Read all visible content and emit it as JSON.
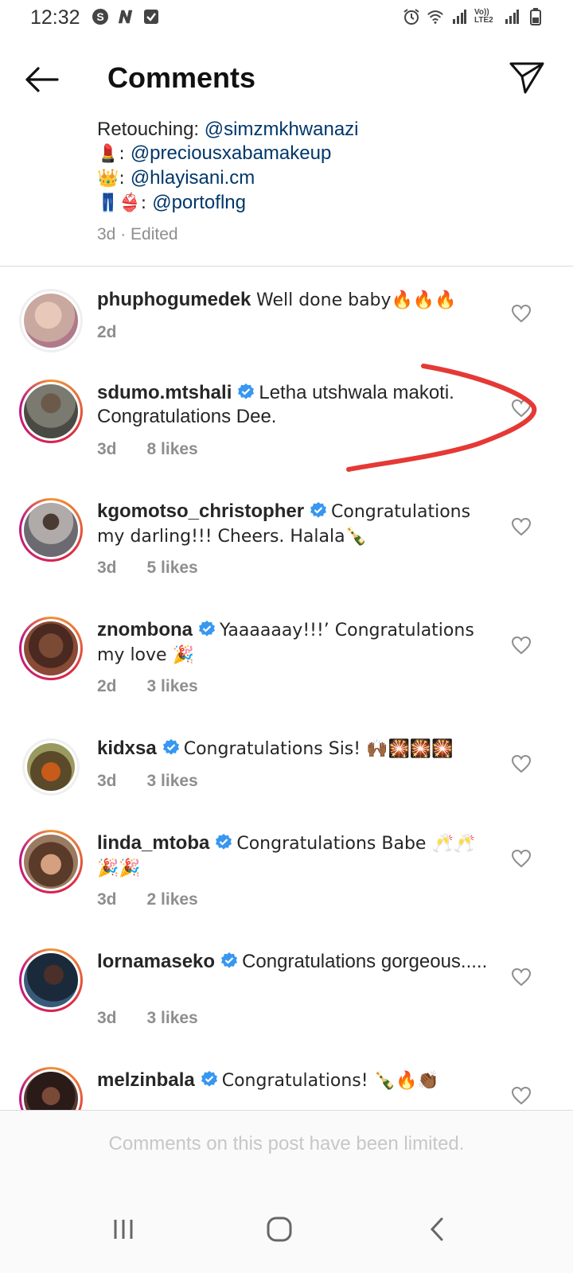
{
  "status_bar": {
    "time": "12:32",
    "left_icons": [
      "skype-icon",
      "n-icon",
      "check-icon"
    ],
    "right_icons": [
      "alarm-icon",
      "wifi-icon",
      "signal-icon",
      "volte-icon",
      "signal-icon",
      "battery-icon"
    ],
    "volte_label": "Vo)) LTE2"
  },
  "header": {
    "title": "Comments"
  },
  "caption": {
    "lines": [
      {
        "prefix": "Retouching: ",
        "mention": "@simzmkhwanazi"
      },
      {
        "prefix": "💄: ",
        "mention": "@preciousxabamakeup"
      },
      {
        "prefix": "👑: ",
        "mention": "@hlayisani.cm"
      },
      {
        "prefix": "👖👙: ",
        "mention": "@portoflng"
      }
    ],
    "meta": "3d · Edited"
  },
  "comments": [
    {
      "username": "phuphogumedek",
      "verified": false,
      "text": "Well done baby🔥🔥🔥",
      "time": "2d",
      "likes": "",
      "story_ring": false,
      "avatar_color": "#c9a8a0"
    },
    {
      "username": "sdumo.mtshali",
      "verified": true,
      "text": "Letha utshwala makoti. Congratulations Dee.",
      "time": "3d",
      "likes": "8 likes",
      "story_ring": true,
      "avatar_color": "#5a5a52"
    },
    {
      "username": "kgomotso_christopher",
      "verified": true,
      "text": "Congratulations my darling!!! Cheers. Halala🍾",
      "time": "3d",
      "likes": "5 likes",
      "story_ring": true,
      "avatar_color": "#8d8f94"
    },
    {
      "username": "znombona",
      "verified": true,
      "text": "Yaaaaaay!!!’ Congratulations my love 🎉",
      "time": "2d",
      "likes": "3 likes",
      "story_ring": true,
      "avatar_color": "#6e4130"
    },
    {
      "username": "kidxsa",
      "verified": true,
      "text": "Congratulations Sis! 🙌🏾🎇🎇🎇",
      "time": "3d",
      "likes": "3 likes",
      "story_ring": false,
      "avatar_color": "#7a6a3a"
    },
    {
      "username": "linda_mtoba",
      "verified": true,
      "text": "Congratulations Babe 🥂🥂🎉🎉",
      "time": "3d",
      "likes": "2 likes",
      "story_ring": true,
      "avatar_color": "#8a6a58"
    },
    {
      "username": "lornamaseko",
      "verified": true,
      "text": "Congratulations gorgeous.....",
      "time": "3d",
      "likes": "3 likes",
      "story_ring": true,
      "avatar_color": "#2f4a66"
    },
    {
      "username": "melzinbala",
      "verified": true,
      "text": "Congratulations! 🍾🔥👏🏾",
      "time": "",
      "likes": "",
      "story_ring": true,
      "avatar_color": "#5a3a30"
    }
  ],
  "footer": {
    "limited_text": "Comments on this post have been limited."
  },
  "colors": {
    "verified": "#3897f0",
    "mention": "#00376b",
    "annotation": "#e53935"
  }
}
